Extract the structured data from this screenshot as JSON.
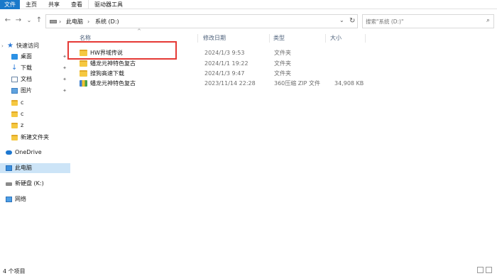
{
  "ribbon": {
    "tabs": [
      "文件",
      "主页",
      "共享",
      "查看",
      "驱动器工具"
    ]
  },
  "nav": {
    "back": "←",
    "forward": "→",
    "recent": "⌄",
    "up": "↑",
    "breadcrumb": [
      "此电脑",
      "系统 (D:)"
    ],
    "search_placeholder": "搜索\"系统 (D:)\""
  },
  "sidebar": {
    "quick_access": "快速访问",
    "items": [
      {
        "label": "桌面",
        "icon": "desktop-icon",
        "pinned": true
      },
      {
        "label": "下载",
        "icon": "download-icon",
        "pinned": true
      },
      {
        "label": "文档",
        "icon": "document-icon",
        "pinned": true
      },
      {
        "label": "图片",
        "icon": "picture-icon",
        "pinned": true
      },
      {
        "label": "c",
        "icon": "folder-icon",
        "pinned": false
      },
      {
        "label": "c",
        "icon": "folder-icon",
        "pinned": false
      },
      {
        "label": "z",
        "icon": "folder-icon",
        "pinned": false
      },
      {
        "label": "新建文件夹",
        "icon": "folder-icon",
        "pinned": false
      }
    ],
    "onedrive": "OneDrive",
    "this_pc": "此电脑",
    "drive_k": "新硬盘 (K:)",
    "network": "网络"
  },
  "columns": {
    "name": "名称",
    "modified": "修改日期",
    "type": "类型",
    "size": "大小"
  },
  "files": [
    {
      "name": "HW界域传说",
      "modified": "2024/1/3 9:53",
      "type": "文件夹",
      "size": "",
      "icon": "folder-icon"
    },
    {
      "name": "蟠龙元神特色复古",
      "modified": "2024/1/1 19:22",
      "type": "文件夹",
      "size": "",
      "icon": "folder-icon"
    },
    {
      "name": "搜狗高速下载",
      "modified": "2024/1/3 9:47",
      "type": "文件夹",
      "size": "",
      "icon": "folder-icon"
    },
    {
      "name": "蟠龙元神特色复古",
      "modified": "2023/11/14 22:28",
      "type": "360压缩 ZIP 文件",
      "size": "34,908 KB",
      "icon": "zip-archive-icon"
    }
  ],
  "status": {
    "item_count": "4 个项目"
  },
  "colors": {
    "accent": "#1979ca",
    "highlight_box": "#e53935",
    "selection": "#cce4f7"
  }
}
